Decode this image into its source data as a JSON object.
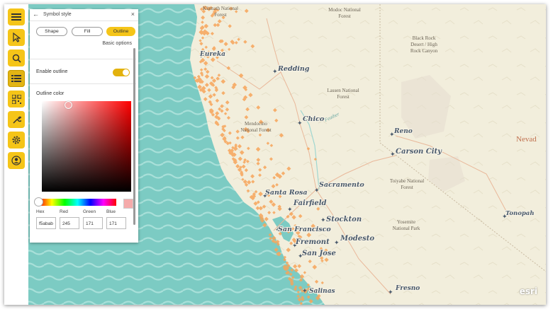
{
  "toolbar": {
    "buttons": [
      {
        "icon": "menu-icon"
      },
      {
        "icon": "pointer-icon"
      },
      {
        "icon": "search-icon"
      },
      {
        "icon": "layers-list-icon"
      },
      {
        "icon": "qr-grid-icon"
      },
      {
        "icon": "wrench-icon"
      },
      {
        "icon": "gear-icon"
      },
      {
        "icon": "user-icon"
      }
    ]
  },
  "panel": {
    "title": "Symbol style",
    "tabs": [
      "Shape",
      "Fill",
      "Outline"
    ],
    "selected_tab": "Outline",
    "basic_options": "Basic options",
    "enable_outline_label": "Enable outline",
    "enable_outline": true,
    "outline_color_label": "Outline color",
    "fields": {
      "hex_label": "Hex",
      "hex": "f5abab",
      "red_label": "Red",
      "red": "245",
      "green_label": "Green",
      "green": "171",
      "blue_label": "Blue",
      "blue": "171"
    }
  },
  "map": {
    "places": [
      {
        "name": "Eureka"
      },
      {
        "name": "Redding"
      },
      {
        "name": "Chico"
      },
      {
        "name": "Reno"
      },
      {
        "name": "Carson City"
      },
      {
        "name": "Sacramento"
      },
      {
        "name": "Santa Rosa"
      },
      {
        "name": "Fairfield"
      },
      {
        "name": "Stockton"
      },
      {
        "name": "San Francisco"
      },
      {
        "name": "Modesto"
      },
      {
        "name": "Fremont"
      },
      {
        "name": "San Jose"
      },
      {
        "name": "Tonopah"
      },
      {
        "name": "Fresno"
      },
      {
        "name": "Salinas"
      }
    ],
    "areas": [
      {
        "lines": [
          "Klamath National",
          "Forest"
        ]
      },
      {
        "lines": [
          "Modoc National",
          "Forest"
        ]
      },
      {
        "lines": [
          "Black Rock",
          "Desert / High",
          "Rock Canyon"
        ]
      },
      {
        "lines": [
          "Lassen National",
          "Forest"
        ]
      },
      {
        "lines": [
          "Mendocino",
          "National Forest"
        ]
      },
      {
        "lines": [
          "Toiyabe National",
          "Forest"
        ]
      },
      {
        "lines": [
          "Yosemite",
          "National Park"
        ]
      }
    ],
    "river": "Feather",
    "state_label": "Nevad",
    "attribution": "esri",
    "marker_color": "#f7a55a",
    "water_color": "#7ccbc3",
    "land_color": "#f2eedc"
  }
}
